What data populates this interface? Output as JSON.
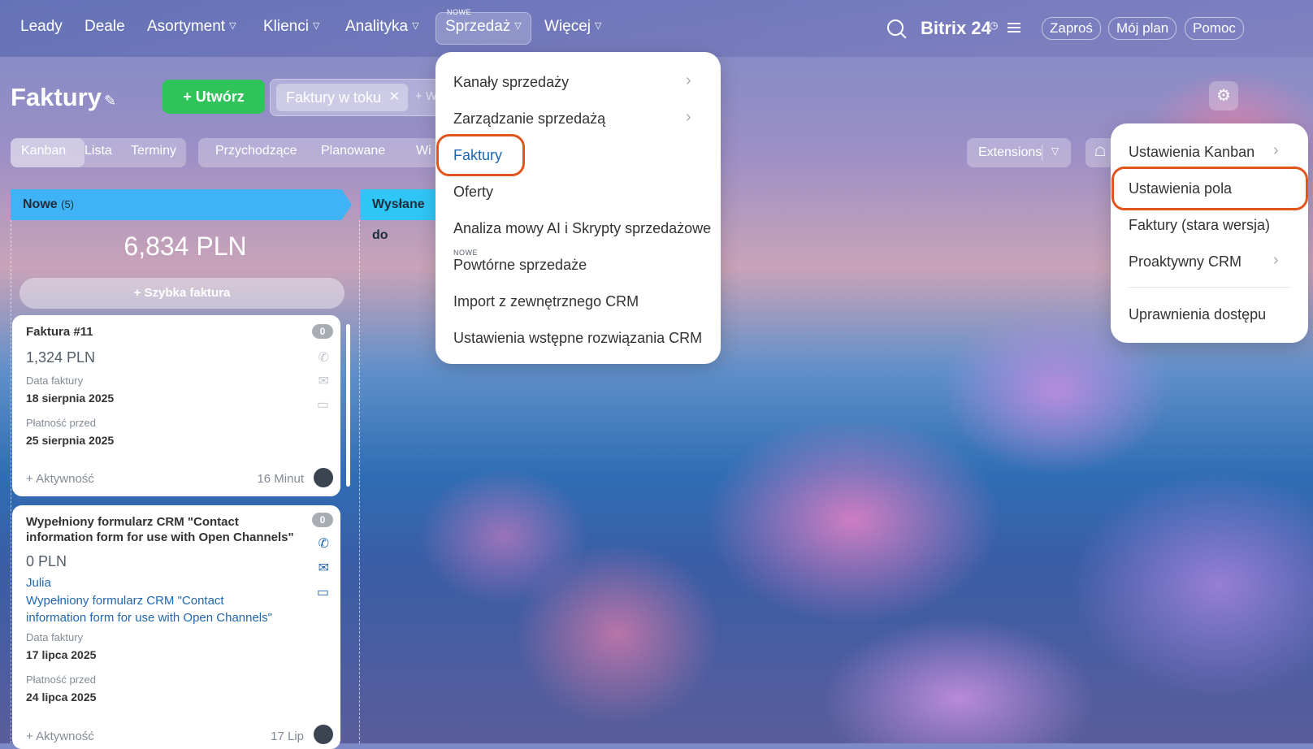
{
  "topnav": {
    "items": [
      {
        "label": "Leady",
        "chevron": false
      },
      {
        "label": "Deale",
        "chevron": false
      },
      {
        "label": "Asortyment",
        "chevron": true
      },
      {
        "label": "Klienci",
        "chevron": true
      },
      {
        "label": "Analityka",
        "chevron": true
      },
      {
        "label": "Sprzedaż",
        "chevron": true,
        "active": true,
        "badge": "NOWE"
      },
      {
        "label": "Więcej",
        "chevron": true
      }
    ],
    "brand": "Bitrix 24",
    "invite": "Zaproś",
    "plan": "Mój plan",
    "help": "Pomoc"
  },
  "page": {
    "title": "Faktury",
    "create_label": "Utwórz",
    "filter_chip": "Faktury w toku",
    "filter_more": "+ W"
  },
  "views": {
    "mode_tabs": [
      "Kanban",
      "Lista",
      "Terminy"
    ],
    "filter_tabs": [
      "Przychodzące",
      "Planowane",
      "Wi"
    ],
    "extensions": "Extensions"
  },
  "kanban": {
    "columns": [
      {
        "title": "Nowe",
        "count": "(5)",
        "color": "#3fb3f5"
      },
      {
        "title": "Wysłane do",
        "color": "#2fc6f6"
      }
    ],
    "sum": "6,834 PLN",
    "quick_invoice": "Szybka faktura",
    "cards": [
      {
        "title": "Faktura #11",
        "amount": "1,324 PLN",
        "date_label": "Data faktury",
        "date": "18 sierpnia 2025",
        "due_label": "Płatność przed",
        "due": "25 sierpnia 2025",
        "activity": "+ Aktywność",
        "time": "16 Minut",
        "badge": "0"
      },
      {
        "title_line1": "Wypełniony formularz CRM \"Contact",
        "title_line2": "information form for use with Open Channels\"",
        "amount": "0 PLN",
        "contact": "Julia",
        "link_line1": "Wypełniony formularz CRM \"Contact",
        "link_line2": "information form for use with Open Channels\"",
        "date_label": "Data faktury",
        "date": "17 lipca 2025",
        "due_label": "Płatność przed",
        "due": "24 lipca 2025",
        "activity": "+ Aktywność",
        "time": "17 Lip",
        "badge": "0"
      }
    ]
  },
  "sales_menu": {
    "items": [
      {
        "label": "Kanały sprzedaży",
        "submenu": true
      },
      {
        "label": "Zarządzanie sprzedażą",
        "submenu": true
      },
      {
        "label": "Faktury",
        "highlighted": true
      },
      {
        "label": "Oferty"
      },
      {
        "label": "Analiza mowy AI i Skrypty sprzedażowe"
      },
      {
        "label": "Powtórne sprzedaże",
        "badge": "NOWE"
      },
      {
        "label": "Import z zewnętrznego CRM"
      },
      {
        "label": "Ustawienia wstępne rozwiązania CRM"
      }
    ]
  },
  "settings_menu": {
    "items": [
      {
        "label": "Ustawienia Kanban",
        "submenu": true
      },
      {
        "label": "Ustawienia pola",
        "highlighted": true
      },
      {
        "label": "Faktury (stara wersja)"
      },
      {
        "label": "Proaktywny CRM",
        "submenu": true
      },
      {
        "label": "Uprawnienia dostępu"
      }
    ]
  },
  "colors": {
    "accent_green": "#2fc35a",
    "highlight": "#e0551d",
    "link": "#2067b0"
  }
}
